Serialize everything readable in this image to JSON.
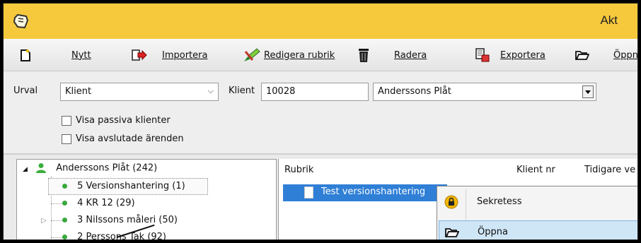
{
  "window": {
    "title": "Akt"
  },
  "toolbar": {
    "new_label": "Nytt",
    "import_label": "Importera",
    "edit_heading_label": "Redigera rubrik",
    "delete_label": "Radera",
    "export_label": "Exportera",
    "open_label": "Öppna"
  },
  "filters": {
    "urval_label": "Urval",
    "urval_value": "Klient",
    "klient_label": "Klient",
    "klient_number": "10028",
    "klient_name": "Anderssons Plåt",
    "show_passive_label": "Visa passiva klienter",
    "show_closed_label": "Visa avslutade ärenden"
  },
  "tree": {
    "root": "Anderssons Plåt (242)",
    "items": [
      "5 Versionshantering (1)",
      "4 KR 12 (29)",
      "3 Nilssons måleri (50)",
      "2 Perssons Tak (92)"
    ]
  },
  "list": {
    "columns": [
      "Rubrik",
      "Klient nr",
      "Tidigare ve"
    ],
    "selected_row": "Test versionshantering"
  },
  "context_menu": {
    "items": [
      "Sekretess",
      "Öppna"
    ]
  },
  "colors": {
    "titlebar": "#f6c93d",
    "selection": "#2f7fd6",
    "menu_hover": "#cfe6f7",
    "tree_dot": "#38a83c"
  }
}
